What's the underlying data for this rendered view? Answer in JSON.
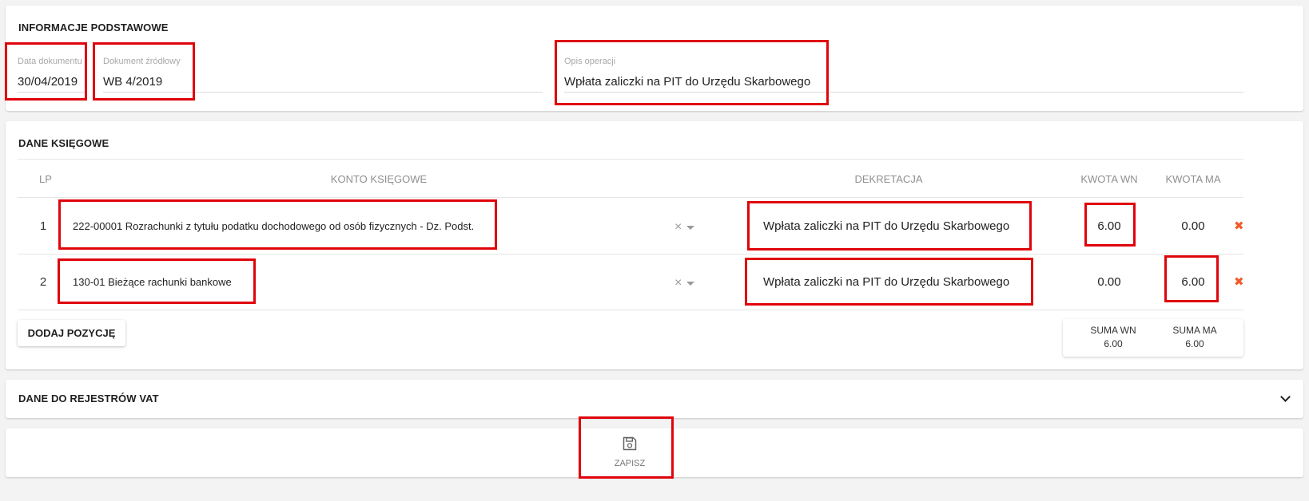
{
  "info": {
    "title": "INFORMACJE PODSTAWOWE",
    "doc_date_label": "Data dokumentu",
    "doc_date_value": "30/04/2019",
    "source_doc_label": "Dokument źródłowy",
    "source_doc_value": "WB 4/2019",
    "operation_label": "Opis operacji",
    "operation_value": "Wpłata zaliczki na PIT do Urzędu Skarbowego"
  },
  "ledger": {
    "title": "DANE KSIĘGOWE",
    "headers": {
      "lp": "LP",
      "account": "KONTO KSIĘGOWE",
      "dekretacja": "DEKRETACJA",
      "wn": "KWOTA WN",
      "ma": "KWOTA MA"
    },
    "rows": [
      {
        "lp": "1",
        "account": "222-00001 Rozrachunki z tytułu podatku dochodowego od osób fizycznych - Dz. Podst.",
        "dekretacja": "Wpłata zaliczki na PIT do Urzędu Skarbowego",
        "wn": "6.00",
        "ma": "0.00"
      },
      {
        "lp": "2",
        "account": "130-01 Bieżące rachunki bankowe",
        "dekretacja": "Wpłata zaliczki na PIT do Urzędu Skarbowego",
        "wn": "0.00",
        "ma": "6.00"
      }
    ],
    "add_button": "DODAJ POZYCJĘ",
    "sum_wn_label": "SUMA WN",
    "sum_wn_value": "6.00",
    "sum_ma_label": "SUMA MA",
    "sum_ma_value": "6.00",
    "icons": {
      "clear": "clear-icon",
      "dropdown": "caret-down-icon",
      "delete": "delete-icon"
    },
    "colors": {
      "delete": "#f05a2a",
      "highlight": "#e0040b"
    }
  },
  "vat": {
    "title": "DANE DO REJESTRÓW VAT",
    "icon": "chevron-down-icon"
  },
  "save": {
    "label": "ZAPISZ",
    "icon": "floppy-disk-icon"
  }
}
